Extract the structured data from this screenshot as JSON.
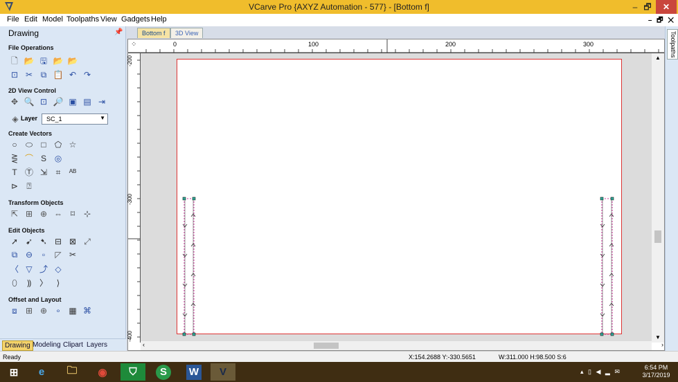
{
  "window": {
    "title": "VCarve Pro {AXYZ Automation - 577} - [Bottom f]",
    "min": "–",
    "restore": "🗗",
    "close": "✕",
    "mdi_controls": "– 🗗 ✕"
  },
  "menu": [
    "File",
    "Edit",
    "Model",
    "Toolpaths",
    "View",
    "Gadgets",
    "Help"
  ],
  "panel": {
    "title": "Drawing",
    "pin": "📌",
    "sections": {
      "file": "File Operations",
      "view2d": "2D View Control",
      "create": "Create Vectors",
      "transform": "Transform Objects",
      "edit": "Edit Objects",
      "offset": "Offset and Layout"
    },
    "layer": {
      "label": "Layer",
      "value": "SC_1",
      "arrow": "▼"
    },
    "bottom_tabs": [
      "Drawing",
      "Modeling",
      "Clipart",
      "Layers"
    ]
  },
  "doc_tabs": [
    "Bottom f",
    "3D View"
  ],
  "ruler": {
    "top_labels": [
      "0",
      "100",
      "200",
      "300"
    ],
    "left_labels": [
      "-200",
      "-300",
      "-400"
    ]
  },
  "right_bar": {
    "tab": "Toolpaths"
  },
  "status": {
    "left": "Ready",
    "coords": "X:154.2688 Y:-330.5651",
    "dims": "W:311.000  H:98.500  S:6"
  },
  "taskbar": {
    "time": "6:54 PM",
    "date": "3/17/2019"
  },
  "colors": {
    "title": "#f0bd2c",
    "panel": "#dbe7f5",
    "taskbar": "#3f2d12",
    "material_border": "#dd3333",
    "vector": "#cc3399"
  }
}
